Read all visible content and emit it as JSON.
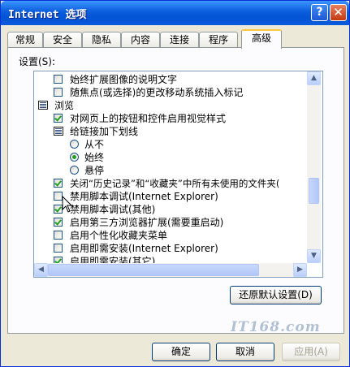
{
  "window": {
    "title": "Internet 选项",
    "help_glyph": "?",
    "close_glyph": "✕"
  },
  "tabs": [
    {
      "label": "常规"
    },
    {
      "label": "安全"
    },
    {
      "label": "隐私"
    },
    {
      "label": "内容"
    },
    {
      "label": "连接"
    },
    {
      "label": "程序"
    },
    {
      "label": "高级",
      "active": true
    }
  ],
  "settings": {
    "label": "设置(S):",
    "items": [
      {
        "kind": "checkbox",
        "checked": false,
        "label": "始终扩展图像的说明文字"
      },
      {
        "kind": "checkbox",
        "checked": false,
        "label": "随焦点(或选择)的更改移动系统插入标记"
      },
      {
        "kind": "folder",
        "label": "浏览"
      },
      {
        "kind": "checkbox",
        "checked": true,
        "label": "对网页上的按钮和控件启用视觉样式"
      },
      {
        "kind": "folder",
        "label": "给链接加下划线"
      },
      {
        "kind": "radio",
        "checked": false,
        "label": "从不"
      },
      {
        "kind": "radio",
        "checked": true,
        "label": "始终"
      },
      {
        "kind": "radio",
        "checked": false,
        "label": "悬停"
      },
      {
        "kind": "checkbox",
        "checked": true,
        "label": "关闭“历史记录”和“收藏夹”中所有未使用的文件夹("
      },
      {
        "kind": "checkbox",
        "checked": false,
        "label": "禁用脚本调试(Internet Explorer)"
      },
      {
        "kind": "checkbox",
        "checked": true,
        "label": "禁用脚本调试(其他)"
      },
      {
        "kind": "checkbox",
        "checked": true,
        "label": "启用第三方浏览器扩展(需要重启动)"
      },
      {
        "kind": "checkbox",
        "checked": false,
        "label": "启用个性化收藏夹菜单"
      },
      {
        "kind": "checkbox",
        "checked": false,
        "label": "启用即需安装(Internet Explorer)"
      },
      {
        "kind": "checkbox",
        "checked": true,
        "label": "启用即需安装(其它)"
      }
    ]
  },
  "scroll": {
    "up": "▲",
    "down": "▼",
    "left": "◀",
    "right": "▶"
  },
  "restore_button": "还原默认设置(D)",
  "buttons": {
    "ok": "确定",
    "cancel": "取消",
    "apply": "应用(A)"
  },
  "watermark": "IT168.com"
}
